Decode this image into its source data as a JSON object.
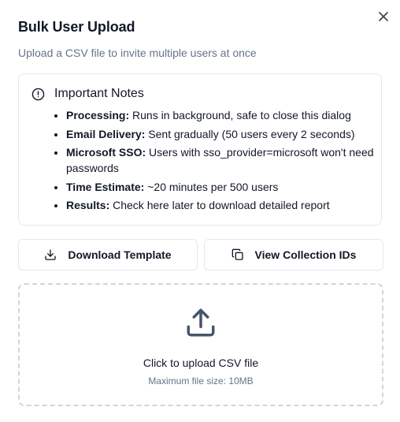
{
  "dialog": {
    "title": "Bulk User Upload",
    "subtitle": "Upload a CSV file to invite multiple users at once",
    "close_icon": "close-icon"
  },
  "notes": {
    "icon": "alert-circle-icon",
    "title": "Important Notes",
    "items": [
      {
        "label": "Processing:",
        "text": " Runs in background, safe to close this dialog"
      },
      {
        "label": "Email Delivery:",
        "text": " Sent gradually (50 users every 2 seconds)"
      },
      {
        "label": "Microsoft SSO:",
        "text": " Users with sso_provider=microsoft won't need passwords"
      },
      {
        "label": "Time Estimate:",
        "text": " ~20 minutes per 500 users"
      },
      {
        "label": "Results:",
        "text": " Check here later to download detailed report"
      }
    ]
  },
  "actions": {
    "download_template": {
      "label": "Download Template",
      "icon": "download-icon"
    },
    "view_collection_ids": {
      "label": "View Collection IDs",
      "icon": "copy-icon"
    }
  },
  "upload": {
    "icon": "upload-icon",
    "label": "Click to upload CSV file",
    "hint": "Maximum file size: 10MB"
  },
  "colors": {
    "text": "#111827",
    "muted": "#64748b",
    "border": "#e5e7eb",
    "dashed_border": "#d1d5db",
    "icon": "#475569"
  }
}
